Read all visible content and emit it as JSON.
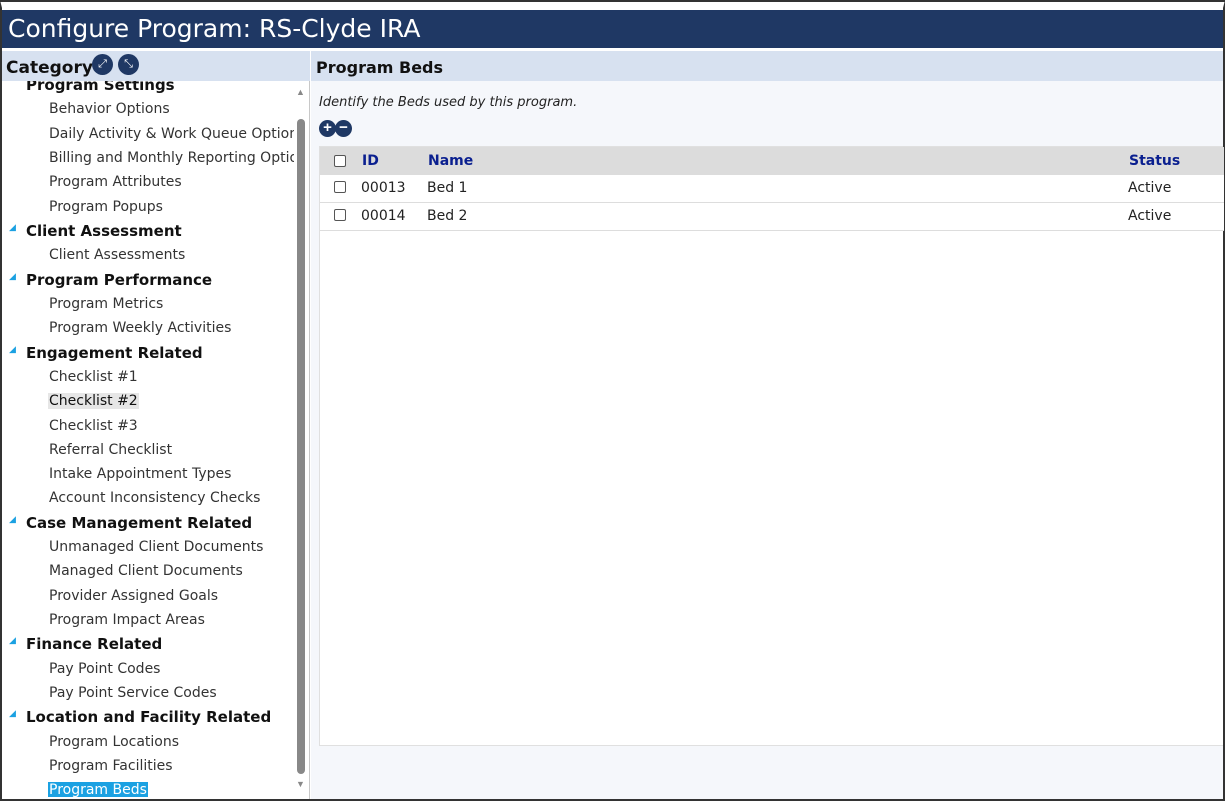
{
  "window": {
    "title": "Configure Program: RS-Clyde IRA"
  },
  "sidebar": {
    "header": "Category",
    "expand_icon": "expand-all-icon",
    "collapse_icon": "collapse-all-icon",
    "groups": [
      {
        "label": "Program Settings",
        "items": [
          "Behavior Options",
          "Daily Activity & Work Queue Options",
          "Billing and Monthly Reporting Options",
          "Program Attributes",
          "Program Popups"
        ]
      },
      {
        "label": "Client Assessment",
        "items": [
          "Client Assessments"
        ]
      },
      {
        "label": "Program Performance",
        "items": [
          "Program Metrics",
          "Program Weekly Activities"
        ]
      },
      {
        "label": "Engagement Related",
        "items": [
          "Checklist #1",
          "Checklist #2",
          "Checklist #3",
          "Referral Checklist",
          "Intake Appointment Types",
          "Account Inconsistency Checks"
        ]
      },
      {
        "label": "Case Management Related",
        "items": [
          "Unmanaged Client Documents",
          "Managed Client Documents",
          "Provider Assigned Goals",
          "Program Impact Areas"
        ]
      },
      {
        "label": "Finance Related",
        "items": [
          "Pay Point Codes",
          "Pay Point Service Codes"
        ]
      },
      {
        "label": "Location and Facility Related",
        "items": [
          "Program Locations",
          "Program Facilities",
          "Program Beds"
        ]
      }
    ],
    "hovered_item": "Checklist #2",
    "selected_item": "Program Beds"
  },
  "main": {
    "title": "Program Beds",
    "description": "Identify the Beds used by this program.",
    "add_icon": "plus-circle-icon",
    "remove_icon": "minus-circle-icon",
    "table": {
      "columns": [
        "ID",
        "Name",
        "Status"
      ],
      "rows": [
        {
          "id": "00013",
          "name": "Bed 1",
          "status": "Active"
        },
        {
          "id": "00014",
          "name": "Bed 2",
          "status": "Active"
        }
      ]
    }
  },
  "colors": {
    "titlebar": "#1f3864",
    "panel_header": "#d7e1f0",
    "selection": "#1ba1e2",
    "header_text": "#0a1f8f"
  }
}
